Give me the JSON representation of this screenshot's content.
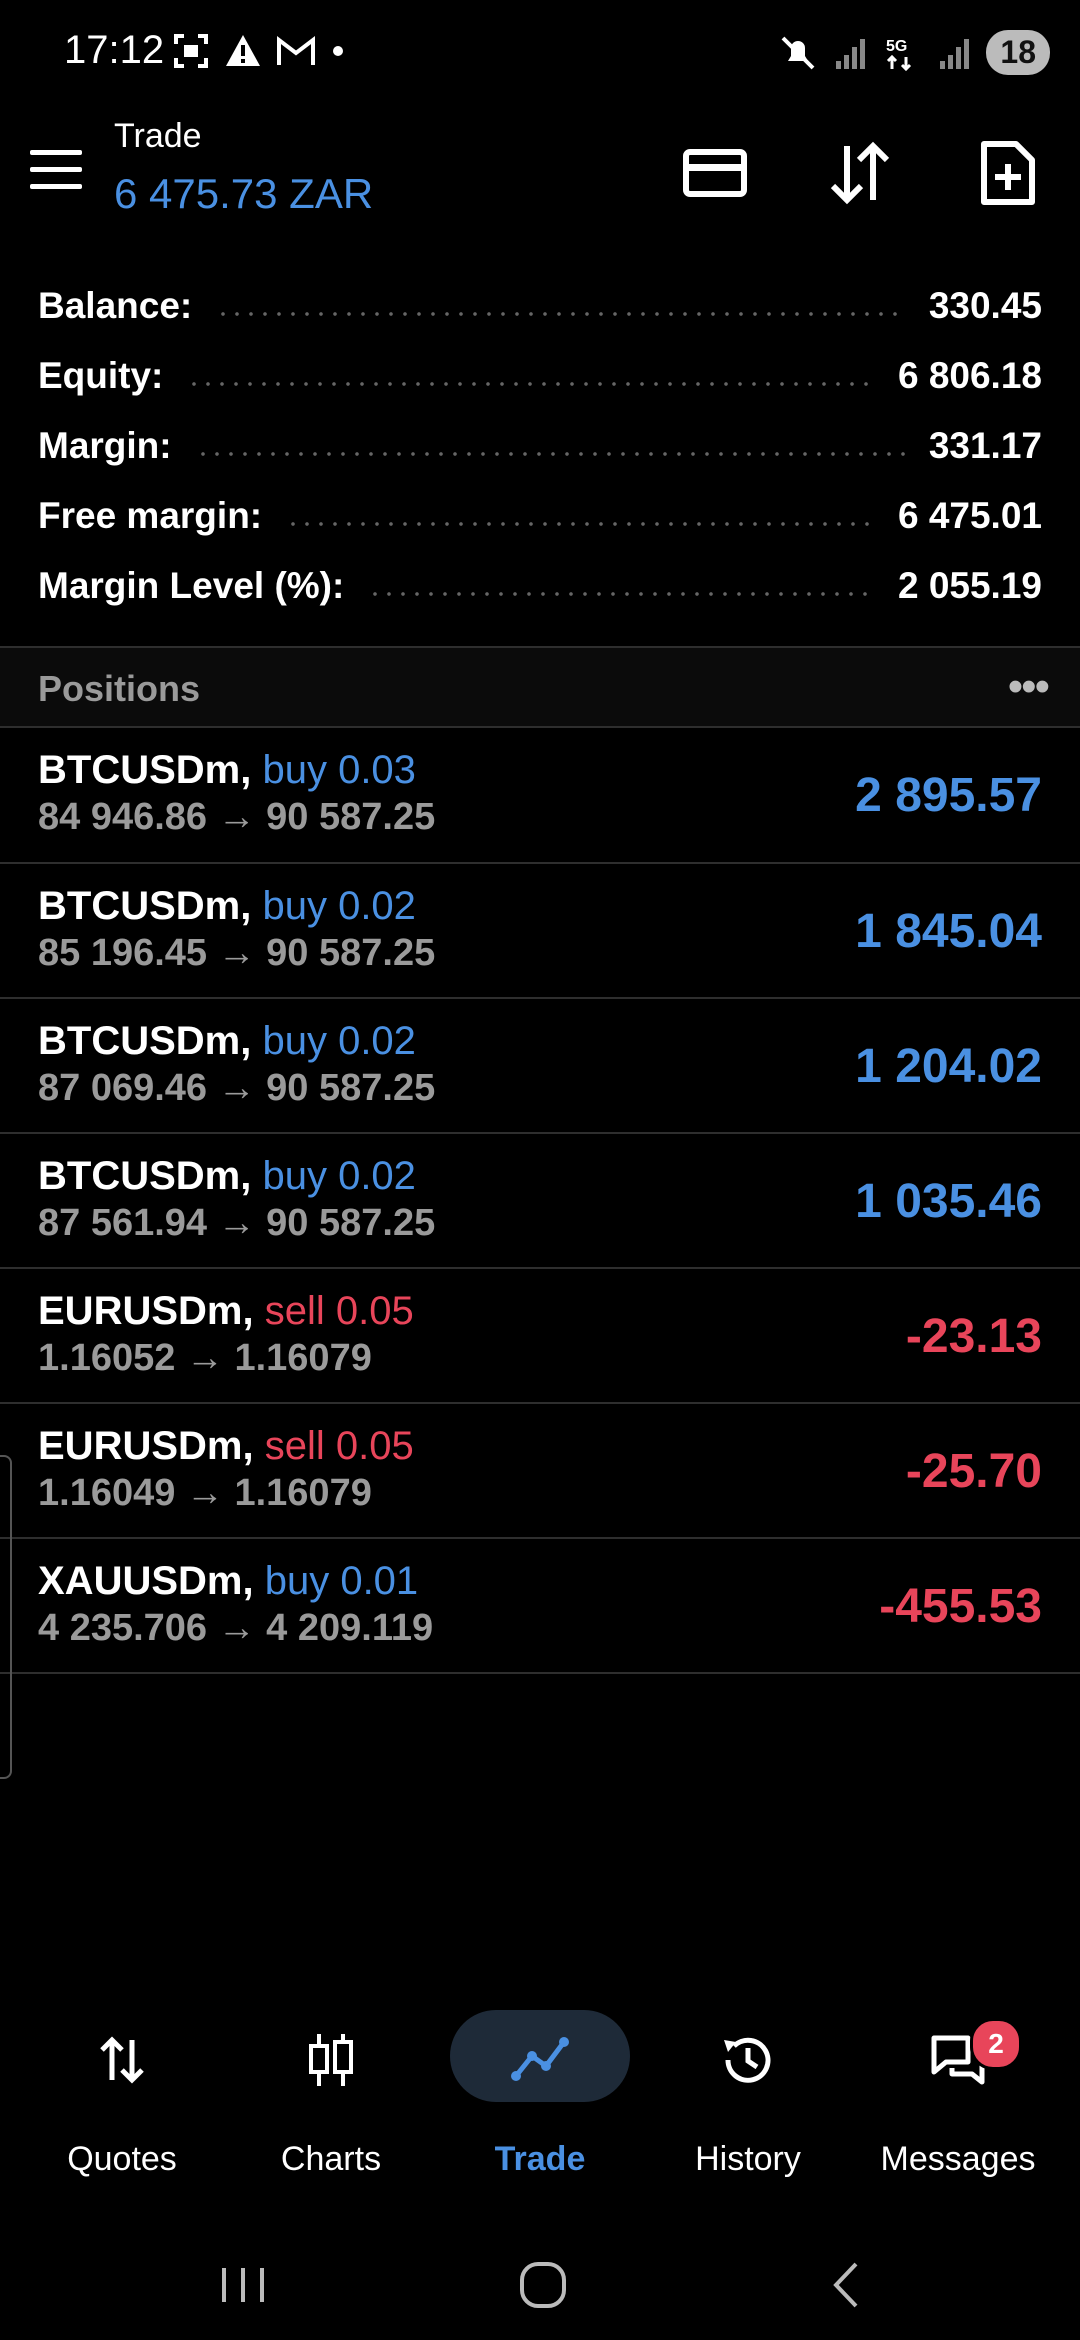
{
  "status_bar": {
    "time": "17:12",
    "battery": "18",
    "network": "5G"
  },
  "header": {
    "title": "Trade",
    "subtitle": "6 475.73 ZAR",
    "icons": [
      "card-icon",
      "sort-arrows-icon",
      "new-order-document-icon"
    ]
  },
  "summary": [
    {
      "label": "Balance:",
      "value": "330.45"
    },
    {
      "label": "Equity:",
      "value": "6 806.18"
    },
    {
      "label": "Margin:",
      "value": "331.17"
    },
    {
      "label": "Free margin:",
      "value": "6 475.01"
    },
    {
      "label": "Margin Level (%):",
      "value": "2 055.19"
    }
  ],
  "positions": {
    "title": "Positions",
    "more": "•••",
    "items": [
      {
        "symbol": "BTCUSDm,",
        "side": "buy 0.03",
        "prices": "84 946.86 → 90 587.25",
        "profit": "2 895.57"
      },
      {
        "symbol": "BTCUSDm,",
        "side": "buy 0.02",
        "prices": "85 196.45 → 90 587.25",
        "profit": "1 845.04"
      },
      {
        "symbol": "BTCUSDm,",
        "side": "buy 0.02",
        "prices": "87 069.46 → 90 587.25",
        "profit": "1 204.02"
      },
      {
        "symbol": "BTCUSDm,",
        "side": "buy 0.02",
        "prices": "87 561.94 → 90 587.25",
        "profit": "1 035.46"
      },
      {
        "symbol": "EURUSDm,",
        "side": "sell 0.05",
        "prices": "1.16052 → 1.16079",
        "profit": "-23.13"
      },
      {
        "symbol": "EURUSDm,",
        "side": "sell 0.05",
        "prices": "1.16049 → 1.16079",
        "profit": "-25.70"
      },
      {
        "symbol": "XAUUSDm,",
        "side": "buy 0.01",
        "prices": "4 235.706 → 4 209.119",
        "profit": "-455.53"
      }
    ]
  },
  "bottom_nav": {
    "items": [
      {
        "label": "Quotes",
        "icon": "quotes-arrows-icon"
      },
      {
        "label": "Charts",
        "icon": "candlestick-icon"
      },
      {
        "label": "Trade",
        "icon": "trend-line-icon",
        "active": true
      },
      {
        "label": "History",
        "icon": "history-clock-icon"
      },
      {
        "label": "Messages",
        "icon": "chat-bubbles-icon",
        "badge": "2"
      }
    ]
  },
  "colors": {
    "accent": "#4a90e2",
    "negative": "#e8455a",
    "background": "#000000",
    "muted_text": "#9a9a9a"
  }
}
